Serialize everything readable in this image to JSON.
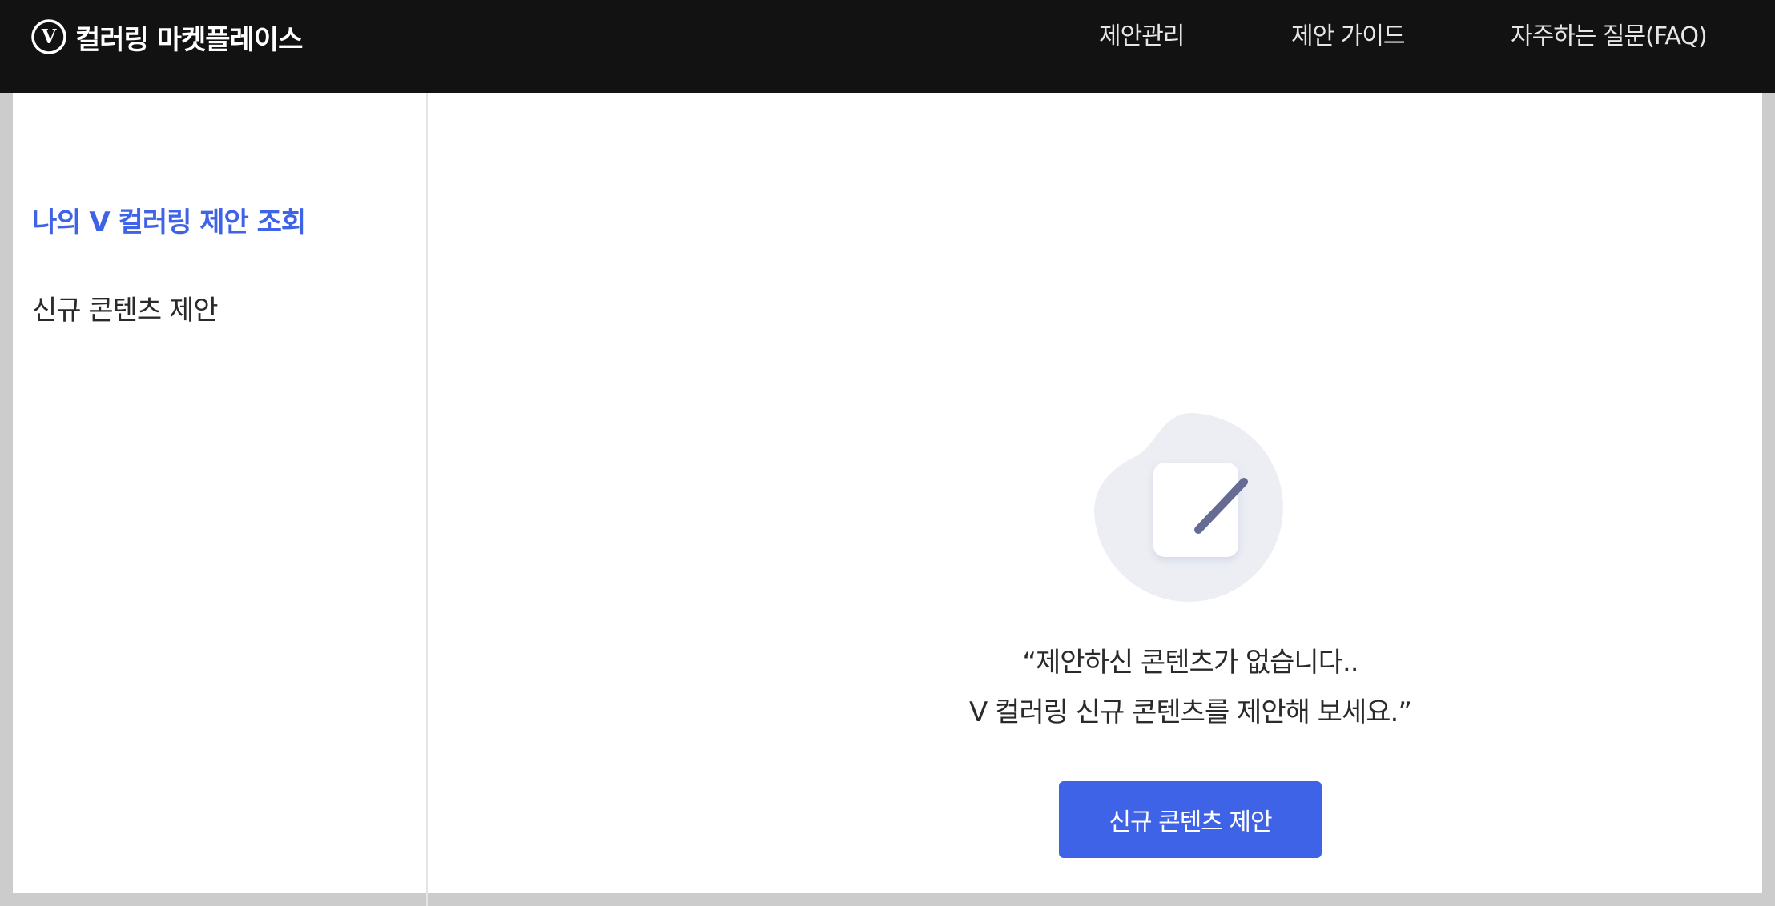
{
  "header": {
    "brand_name": "컬러링 마켓플레이스",
    "brand_logo_letter": "V",
    "nav": [
      {
        "label": "제안관리"
      },
      {
        "label": "제안 가이드"
      },
      {
        "label": "자주하는 질문(FAQ)"
      }
    ]
  },
  "sidebar": {
    "items": [
      {
        "label": "나의 V 컬러링 제안 조회",
        "active": true
      },
      {
        "label": "신규 콘텐츠 제안",
        "active": false
      }
    ]
  },
  "main": {
    "empty_state": {
      "line1": "“제안하신 콘텐츠가 없습니다..",
      "line2": "V 컬러링 신규 콘텐츠를 제안해 보세요.”",
      "button_label": "신규 콘텐츠 제안",
      "icon": "edit-note-icon"
    }
  },
  "colors": {
    "topbar": "#121212",
    "accent": "#3f63e6",
    "text": "#2a2a2a",
    "illustration_bg": "#eceef4",
    "pencil": "#656b93"
  }
}
